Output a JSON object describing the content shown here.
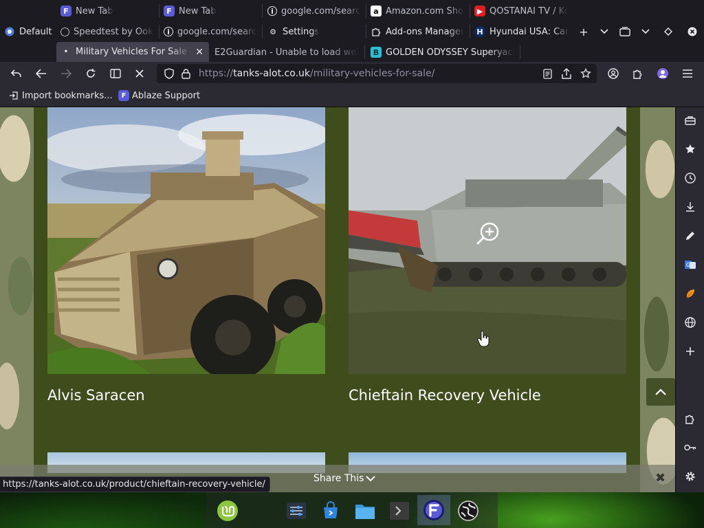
{
  "tabs": {
    "row1": [
      {
        "title": "New Tab",
        "icon": "floorp-icon"
      },
      {
        "title": "New Tab",
        "icon": "floorp-icon"
      },
      {
        "title": "google.com/search",
        "icon": "info-icon"
      },
      {
        "title": "Amazon.com Shop",
        "icon": "amazon-icon"
      },
      {
        "title": "QOSTANAI TV / Ko",
        "icon": "youtube-icon"
      }
    ],
    "row2": [
      {
        "title": "Default",
        "icon": "workspace-icon"
      },
      {
        "title": "Speedtest by Ookla",
        "icon": "speedtest-icon"
      },
      {
        "title": "google.com/search",
        "icon": "info-icon"
      },
      {
        "title": "Settings",
        "icon": "gear-icon"
      },
      {
        "title": "Add-ons Manager",
        "icon": "puzzle-icon"
      },
      {
        "title": "Hyundai USA: Cars",
        "icon": "hyundai-icon"
      }
    ],
    "row3": [
      {
        "title": "Military Vehicles For Sale - T",
        "icon": "loading-dot",
        "active": true
      },
      {
        "title": "E2Guardian - Unable to load web",
        "icon": "none"
      },
      {
        "title": "GOLDEN ODYSSEY Superyacht",
        "icon": "teal-icon"
      }
    ]
  },
  "url": {
    "prefix": "https://",
    "host": "tanks-alot.co.uk",
    "path": "/military-vehicles-for-sale/"
  },
  "bookmarks": [
    {
      "label": "Import bookmarks...",
      "icon": "import-icon"
    },
    {
      "label": "Ablaze Support",
      "icon": "floorp-icon"
    }
  ],
  "products": [
    {
      "title": "Alvis Saracen"
    },
    {
      "title": "Chieftain Recovery Vehicle"
    }
  ],
  "share": {
    "label": "Share This"
  },
  "status_link": "https://tanks-alot.co.uk/product/chieftain-recovery-vehicle/",
  "colors": {
    "panel_bg": "#3f4d1c",
    "toolbar_bg": "#2b2a33",
    "tabstrip_bg": "#1c1b22",
    "accent": "#5b5bd6"
  }
}
